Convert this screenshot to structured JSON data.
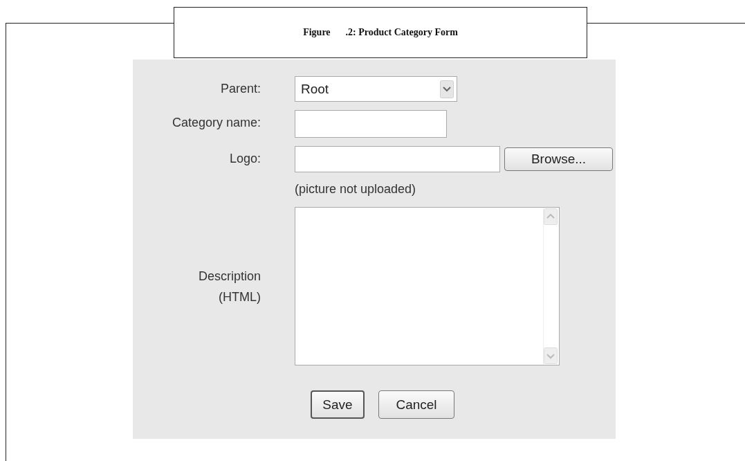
{
  "caption": {
    "label": "Figure",
    "title": ".2: Product Category Form"
  },
  "form": {
    "fields": [
      {
        "kind": "select",
        "label": "Parent:",
        "value": "Root"
      },
      {
        "kind": "text",
        "label": "Category name:"
      },
      {
        "kind": "file",
        "label": "Logo:",
        "button": "Browse...",
        "note": "(picture not uploaded)"
      },
      {
        "kind": "textarea",
        "label": "Description (HTML)"
      }
    ],
    "buttons": [
      "Save",
      "Cancel"
    ]
  }
}
